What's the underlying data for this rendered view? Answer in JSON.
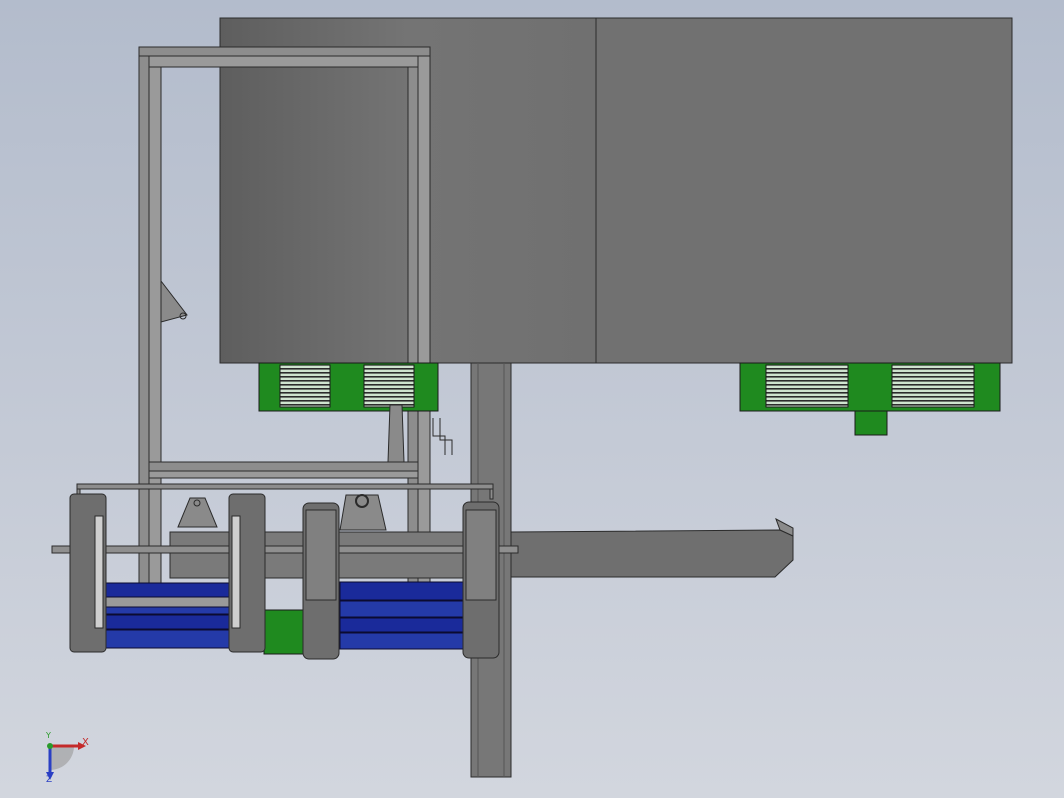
{
  "viewport": {
    "background": "gradient-blue-grey"
  },
  "triad": {
    "x_label": "X",
    "y_label": "Y",
    "z_label": "Z",
    "x_color": "#c42a2a",
    "y_color": "#2a9a2a",
    "z_color": "#2a3fc4"
  },
  "colors": {
    "panel": "#717171",
    "panel_dark": "#5a5a5a",
    "frame": "#8a8a8a",
    "green": "#1f8a1f",
    "blue": "#1a2a9a",
    "wheel": "#6e6e6e",
    "edge": "#2b2b2b"
  }
}
